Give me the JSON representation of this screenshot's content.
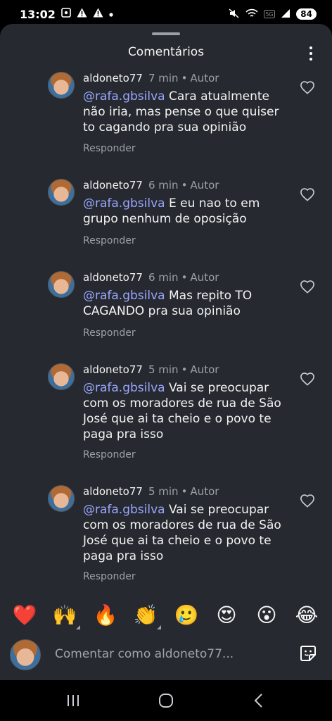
{
  "status_bar": {
    "time": "13:02",
    "left_icons": [
      "screenshot-icon",
      "alert-icon",
      "alert-icon",
      "dot-icon"
    ],
    "right_icons": [
      "mute-icon",
      "wifi-icon",
      "5g-icon",
      "signal-icon"
    ],
    "battery": "84"
  },
  "sheet": {
    "title": "Comentários"
  },
  "comments": [
    {
      "username": "aldoneto77",
      "time": "7 min",
      "author_badge": "Autor",
      "mention": "@rafa.gbsilva",
      "text": "Cara atualmente não iria, mas pense o que quiser to cagando pra sua opinião",
      "reply": "Responder"
    },
    {
      "username": "aldoneto77",
      "time": "6 min",
      "author_badge": "Autor",
      "mention": "@rafa.gbsilva",
      "text": "E eu nao to em grupo nenhum de oposição",
      "reply": "Responder"
    },
    {
      "username": "aldoneto77",
      "time": "6 min",
      "author_badge": "Autor",
      "mention": "@rafa.gbsilva",
      "text": "Mas repito TO CAGANDO pra sua opinião",
      "reply": "Responder"
    },
    {
      "username": "aldoneto77",
      "time": "5 min",
      "author_badge": "Autor",
      "mention": "@rafa.gbsilva",
      "text": "Vai se preocupar com os moradores de rua de São José que ai ta cheio e o povo te paga pra isso",
      "reply": "Responder"
    },
    {
      "username": "aldoneto77",
      "time": "5 min",
      "author_badge": "Autor",
      "mention": "@rafa.gbsilva",
      "text": "Vai se preocupar com os moradores de rua de São José que ai ta cheio e o povo te paga pra isso",
      "reply": "Responder"
    }
  ],
  "reactions": [
    {
      "icon": "heart-emoji",
      "glyph": "❤️"
    },
    {
      "icon": "raising-hands-emoji",
      "glyph": "🙌"
    },
    {
      "icon": "fire-emoji",
      "glyph": "🔥"
    },
    {
      "icon": "clapping-emoji",
      "glyph": "👏"
    },
    {
      "icon": "crying-face-emoji",
      "glyph": "🥲"
    },
    {
      "icon": "heart-eyes-emoji",
      "glyph": "😍"
    },
    {
      "icon": "surprised-face-emoji",
      "glyph": "😮"
    },
    {
      "icon": "laughing-emoji",
      "glyph": "😂"
    }
  ],
  "composer": {
    "placeholder": "Comentar como aldoneto77..."
  },
  "nav": {
    "icons": [
      "recent-apps-icon",
      "home-icon",
      "back-icon"
    ]
  },
  "colors": {
    "sheet_bg": "#262a30",
    "mention": "#9aa6ff",
    "muted": "#9aa0a6"
  }
}
